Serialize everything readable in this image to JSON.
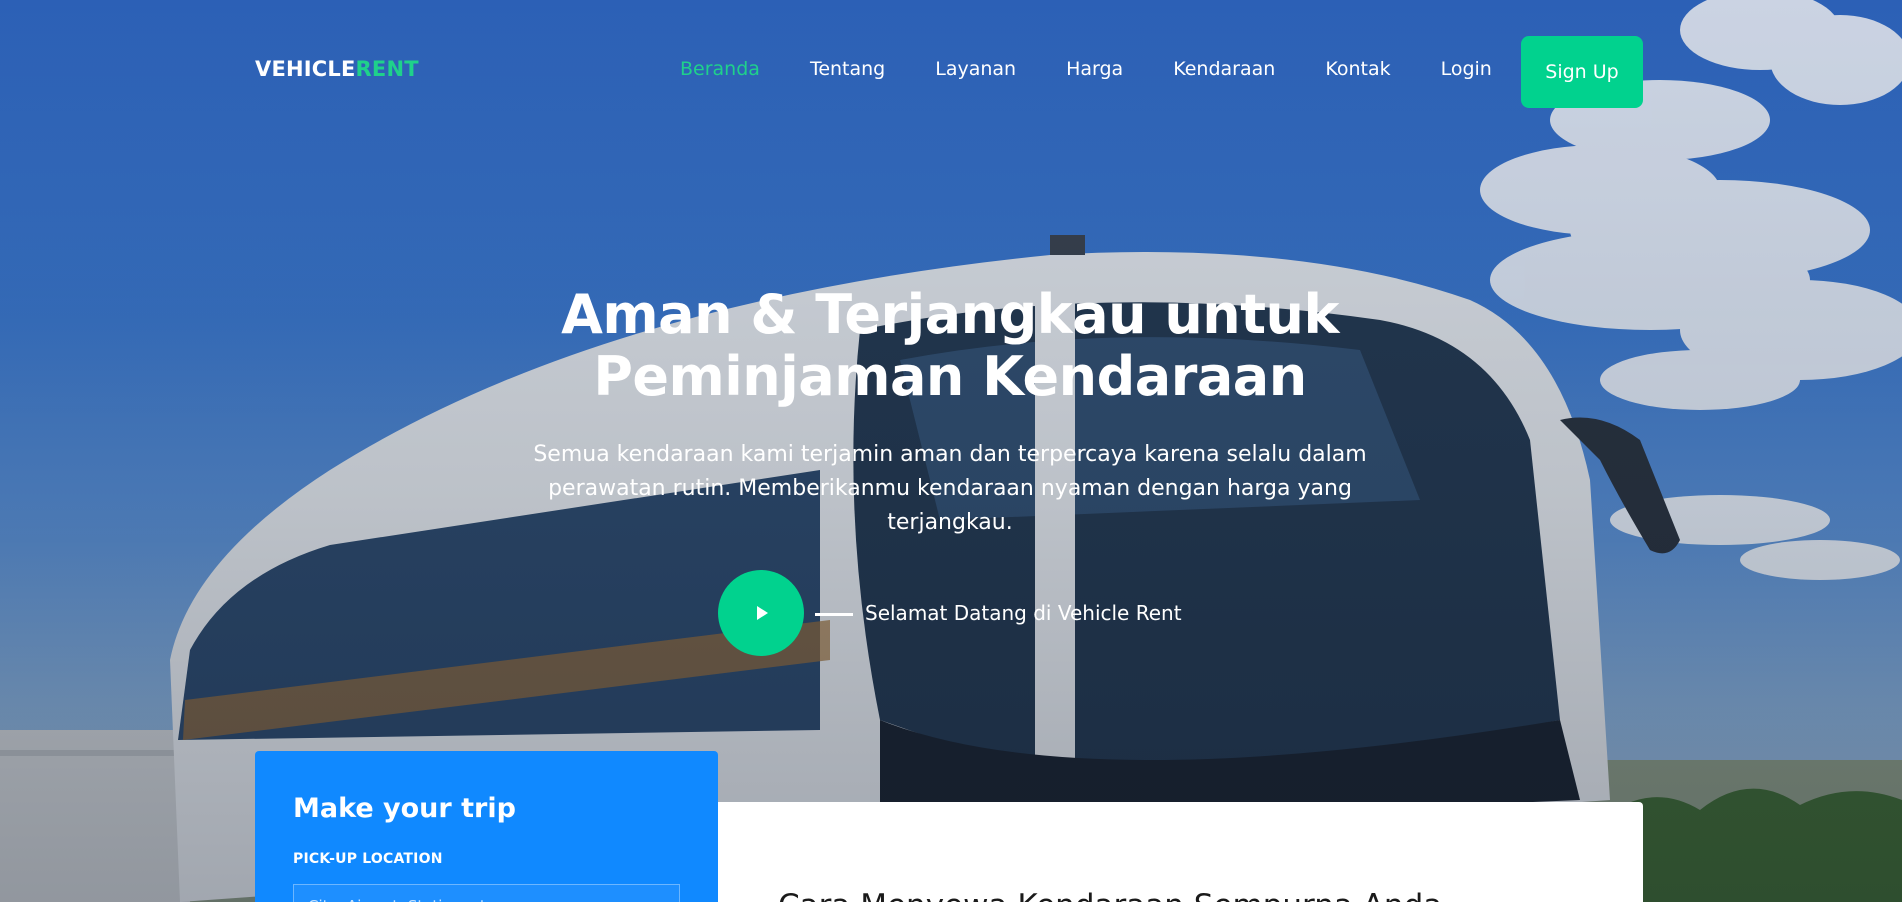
{
  "brand": {
    "part1": "VEHICLE",
    "part2": "RENT"
  },
  "nav": {
    "items": [
      {
        "label": "Beranda",
        "active": true
      },
      {
        "label": "Tentang",
        "active": false
      },
      {
        "label": "Layanan",
        "active": false
      },
      {
        "label": "Harga",
        "active": false
      },
      {
        "label": "Kendaraan",
        "active": false
      },
      {
        "label": "Kontak",
        "active": false
      },
      {
        "label": "Login",
        "active": false
      }
    ],
    "signup_label": "Sign Up"
  },
  "hero": {
    "title_line1": "Aman & Terjangkau untuk",
    "title_line2": "Peminjaman Kendaraan",
    "subtitle": "Semua kendaraan kami terjamin aman dan terpercaya karena selalu dalam perawatan rutin. Memberikanmu kendaraan nyaman dengan harga yang terjangkau.",
    "welcome_text": "Selamat Datang di Vehicle Rent",
    "play_icon": "play-icon"
  },
  "trip": {
    "title": "Make your trip",
    "pickup_label": "PICK-UP LOCATION",
    "pickup_placeholder": "City, Airport, Station, etc"
  },
  "steps": {
    "title": "Cara Menyewa Kendaraan Sempurna Anda"
  },
  "colors": {
    "accent": "#01d28e",
    "primary_blue": "#1089ff",
    "text_white": "#ffffff"
  }
}
